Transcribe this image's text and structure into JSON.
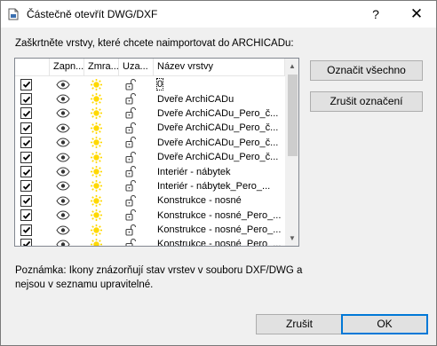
{
  "window": {
    "title": "Částečně otevřít DWG/DXF",
    "help": "?",
    "close": "✕"
  },
  "instruction": "Zaškrtněte vrstvy, které chcete naimportovat do ARCHICADu:",
  "columns": [
    "",
    "Zapn...",
    "Zmra...",
    "Uza...",
    "Název vrstvy"
  ],
  "layers": [
    "0",
    "Dveře ArchiCADu",
    "Dveře ArchiCADu_Pero_č...",
    "Dveře ArchiCADu_Pero_č...",
    "Dveře ArchiCADu_Pero_č...",
    "Dveře ArchiCADu_Pero_č...",
    "Interiér - nábytek",
    "Interiér - nábytek_Pero_...",
    "Konstrukce - nosné",
    "Konstrukce - nosné_Pero_...",
    "Konstrukce - nosné_Pero_...",
    "Konstrukce - nosné_Pero_..."
  ],
  "checked": [
    true,
    true,
    true,
    true,
    true,
    true,
    true,
    true,
    true,
    true,
    true,
    true
  ],
  "buttons": {
    "mark_all": "Označit všechno",
    "unmark": "Zrušit označení",
    "cancel": "Zrušit",
    "ok": "OK"
  },
  "note": "Poznámka: Ikony znázorňují stav vrstev v souboru DXF/DWG a nejsou v seznamu upravitelné.",
  "colors": {
    "sun": "#ffd800",
    "accent": "#0078d7"
  },
  "icons": {
    "on": "eye-icon",
    "freeze": "sun-icon",
    "lock": "unlock-icon",
    "app": "dwg-file-icon"
  }
}
